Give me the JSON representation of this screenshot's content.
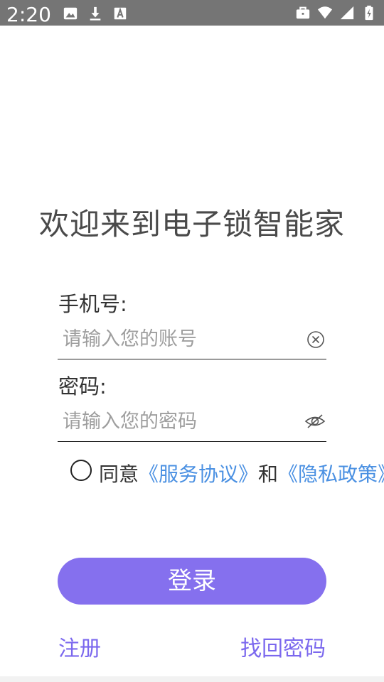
{
  "status_bar": {
    "time": "2:20",
    "left_icons": [
      "image-icon",
      "download-icon",
      "font-icon"
    ],
    "right_icons": [
      "briefcase-icon",
      "wifi-icon",
      "signal-icon",
      "battery-charging-icon"
    ],
    "background": "#757575"
  },
  "page": {
    "title": "欢迎来到电子锁智能家"
  },
  "phone": {
    "label": "手机号:",
    "placeholder": "请输入您的账号",
    "value": ""
  },
  "password": {
    "label": "密码:",
    "placeholder": "请输入您的密码",
    "value": ""
  },
  "agreement": {
    "checked": false,
    "prefix": "同意",
    "service_link": "《服务协议》",
    "and": "和",
    "privacy_link": "《隐私政策》"
  },
  "actions": {
    "login_label": "登录",
    "register_label": "注册",
    "forgot_label": "找回密码"
  },
  "colors": {
    "accent": "#8570ee",
    "link": "#4a90e2",
    "secondary_link": "#7b68ee"
  }
}
